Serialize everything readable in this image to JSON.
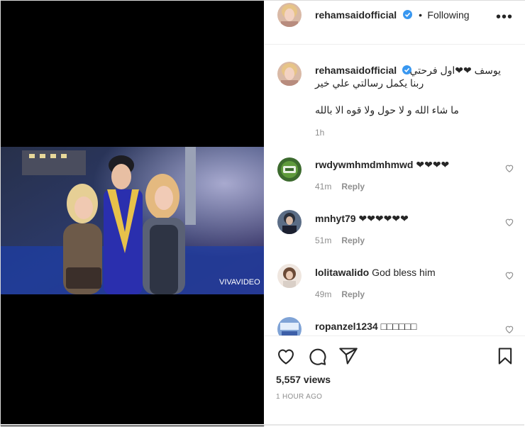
{
  "post": {
    "username": "rehamsaidofficial",
    "separator": "•",
    "follow_status": "Following",
    "more_glyph": "•••",
    "watermark": "VIVAVIDEO"
  },
  "caption": {
    "username": "rehamsaidofficial",
    "line1": "يوسف ❤❤اول فرحتي",
    "line2": "ربنا يكمل رسالتي علي خير",
    "line3": "ما شاء الله و لا حول ولا قوه الا بالله",
    "time": "1h"
  },
  "comments": [
    {
      "username": "rwdywmhmdmhmwd",
      "text": "❤❤❤❤",
      "time": "41m",
      "reply": "Reply"
    },
    {
      "username": "mnhyt79",
      "text": "❤❤❤❤❤❤",
      "time": "51m",
      "reply": "Reply"
    },
    {
      "username": "lolitawalido",
      "text": "God bless him",
      "time": "49m",
      "reply": "Reply"
    },
    {
      "username": "ropanzel1234",
      "text": "□□□□□□",
      "time": "",
      "reply": ""
    }
  ],
  "stats": {
    "views": "5,557 views",
    "posted": "1 HOUR AGO"
  },
  "icons": [
    "like-icon",
    "comment-icon",
    "share-icon",
    "save-icon",
    "verified-icon",
    "more-options-icon",
    "comment-like-icon"
  ],
  "colors": {
    "verified": "#3897f0",
    "muted": "#8e8e8e",
    "text": "#262626",
    "border": "#efefef"
  }
}
